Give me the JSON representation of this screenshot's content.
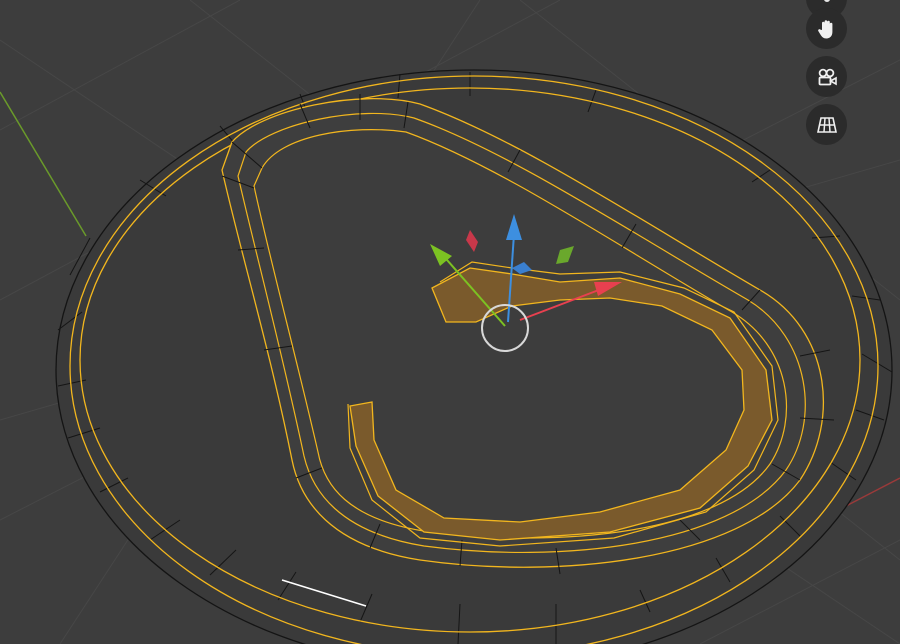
{
  "viewport": {
    "background": "#3d3d3d",
    "grid_color": "#474747",
    "axis_x_color": "#9a3a3a",
    "axis_y_color": "#6a9a2a",
    "selected_edge_color": "#f2b61e",
    "unselected_edge_color": "#111111",
    "active_edge_color": "#ffffff",
    "selected_face_color": "#7a5a2c"
  },
  "gizmo": {
    "x_axis_color": "#e8404f",
    "y_axis_color": "#7cc222",
    "z_axis_color": "#3d8fe0",
    "pivot_ring_color": "#d8d8d8"
  },
  "navigation": {
    "buttons": [
      {
        "name": "partial-button",
        "icon": "menu-icon"
      },
      {
        "name": "pan-view-button",
        "icon": "hand-icon"
      },
      {
        "name": "camera-view-button",
        "icon": "camera-icon"
      },
      {
        "name": "ortho-toggle-button",
        "icon": "grid-icon"
      }
    ]
  }
}
